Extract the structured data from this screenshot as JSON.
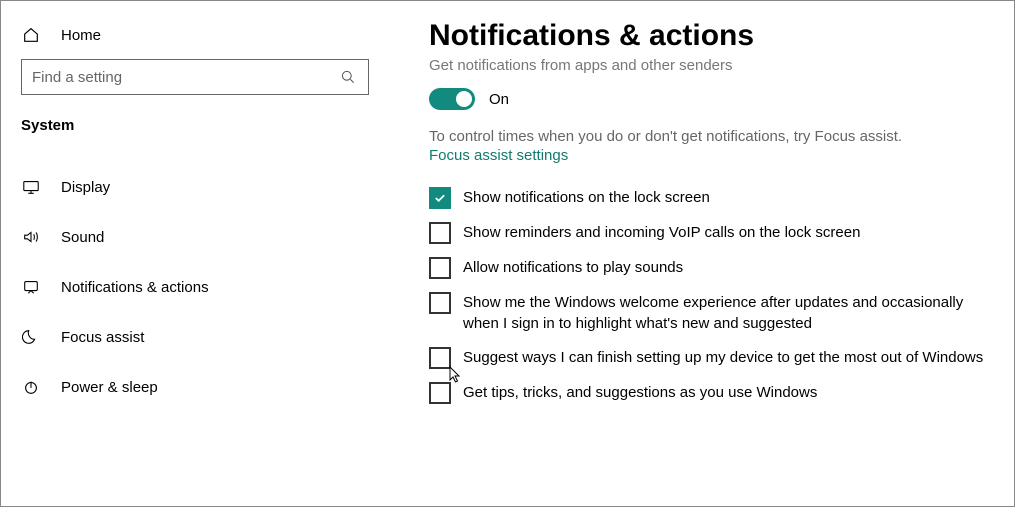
{
  "sidebar": {
    "home": "Home",
    "search_placeholder": "Find a setting",
    "category": "System",
    "items": [
      {
        "label": "Display",
        "icon": "display"
      },
      {
        "label": "Sound",
        "icon": "sound"
      },
      {
        "label": "Notifications & actions",
        "icon": "notifications"
      },
      {
        "label": "Focus assist",
        "icon": "moon"
      },
      {
        "label": "Power & sleep",
        "icon": "power"
      }
    ]
  },
  "main": {
    "title": "Notifications & actions",
    "subheading": "Get notifications from apps and other senders",
    "toggle": {
      "state": "On"
    },
    "info": "To control times when you do or don't get notifications, try Focus assist.",
    "link": "Focus assist settings",
    "checks": [
      {
        "checked": true,
        "label": "Show notifications on the lock screen"
      },
      {
        "checked": false,
        "label": "Show reminders and incoming VoIP calls on the lock screen"
      },
      {
        "checked": false,
        "label": "Allow notifications to play sounds"
      },
      {
        "checked": false,
        "label": "Show me the Windows welcome experience after updates and occasionally when I sign in to highlight what's new and suggested"
      },
      {
        "checked": false,
        "label": "Suggest ways I can finish setting up my device to get the most out of Windows"
      },
      {
        "checked": false,
        "label": "Get tips, tricks, and suggestions as you use Windows"
      }
    ]
  },
  "colors": {
    "accent": "#128b7e"
  }
}
